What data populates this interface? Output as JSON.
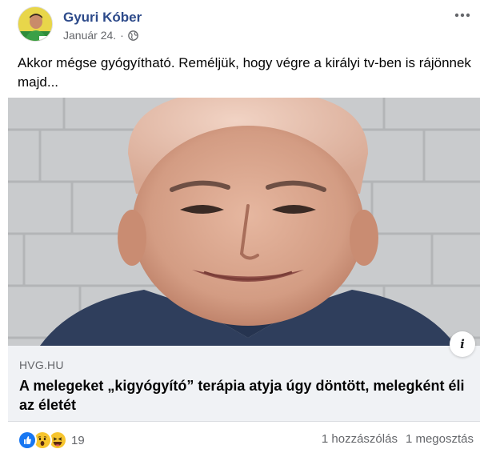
{
  "post": {
    "author": "Gyuri Kóber",
    "date": "Január 24.",
    "separator": "·",
    "privacy_icon": "globe-icon",
    "text": "Akkor mégse gyógyítható. Reméljük, hogy végre a királyi tv-ben is rájönnek majd..."
  },
  "link": {
    "domain": "HVG.HU",
    "title": "A melegeket „kigyógyító” terápia atyja úgy döntött, melegként éli az életét",
    "info_label": "i"
  },
  "engagement": {
    "reaction_icons": [
      "like-icon",
      "wow-icon",
      "haha-icon"
    ],
    "reaction_count": "19",
    "comments": "1 hozzászólás",
    "shares": "1 megosztás"
  },
  "colors": {
    "author": "#2d4a8a",
    "secondary_text": "#65676b",
    "card_background": "#f0f2f5",
    "like_blue": "#1877f2",
    "reaction_yellow": "#f7c52e"
  }
}
